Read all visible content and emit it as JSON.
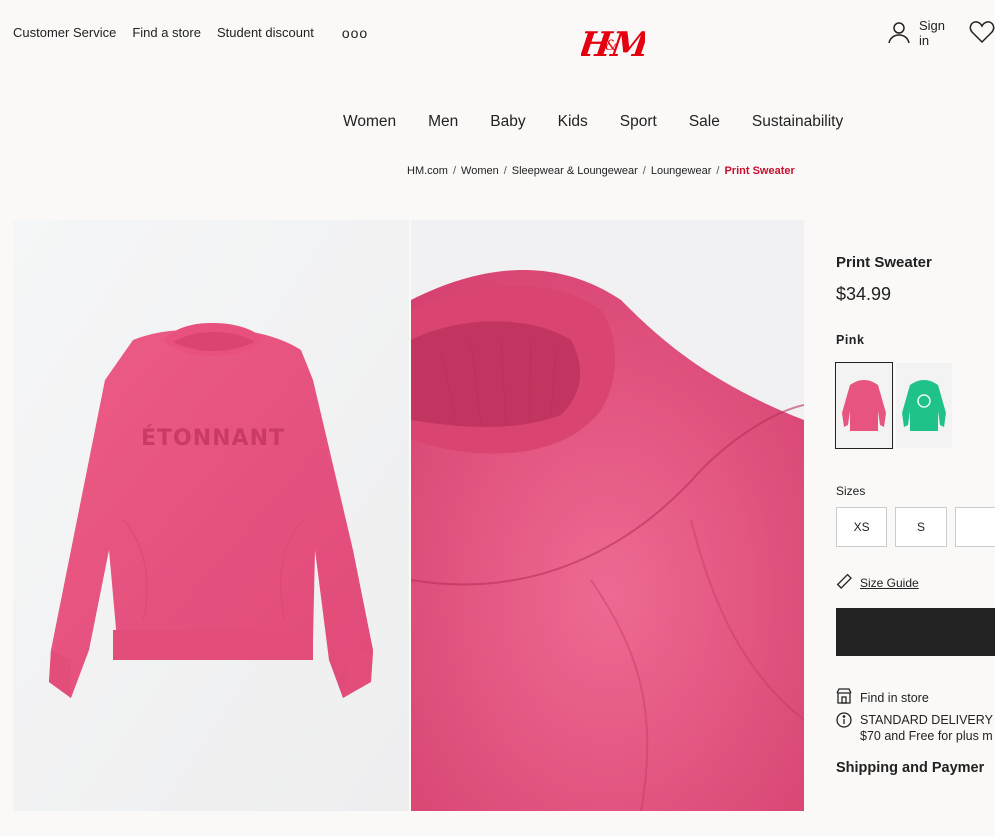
{
  "top_links": [
    "Customer Service",
    "Find a store",
    "Student discount"
  ],
  "more_label": "ooo",
  "brand": {
    "name": "H&M",
    "color": "#e50010"
  },
  "account": {
    "sign_in": "Sign in"
  },
  "nav": [
    "Women",
    "Men",
    "Baby",
    "Kids",
    "Sport",
    "Sale",
    "Sustainability"
  ],
  "breadcrumb": {
    "items": [
      "HM.com",
      "Women",
      "Sleepwear & Loungewear",
      "Loungewear"
    ],
    "separator": "/",
    "current": "Print Sweater"
  },
  "product": {
    "name": "Print Sweater",
    "price": "$34.99",
    "print_text": "ÉTONNANT",
    "color_selected": "Pink",
    "colors": [
      {
        "name": "Pink",
        "hex": "#e85480"
      },
      {
        "name": "Green",
        "hex": "#1fc289"
      }
    ],
    "sizes_label": "Sizes",
    "sizes": [
      "XS",
      "S"
    ],
    "size_guide": "Size Guide",
    "find_in_store": "Find in store",
    "delivery_line1": "STANDARD DELIVERY",
    "delivery_line2": "$70 and Free for plus m",
    "shipping_heading": "Shipping and Paymer"
  },
  "icons": [
    "user-icon",
    "heart-icon",
    "ruler-icon",
    "store-icon",
    "info-icon"
  ],
  "accent_colors": {
    "sale_red": "#c8102e",
    "button_black": "#222222"
  }
}
